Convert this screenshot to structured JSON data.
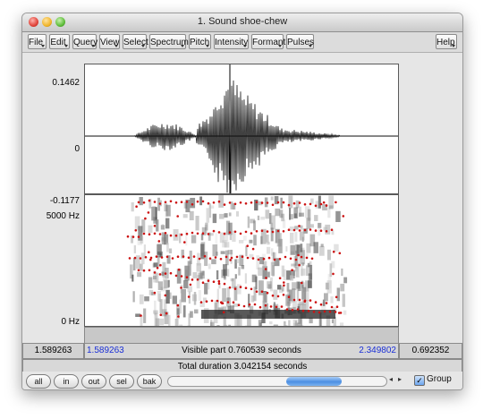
{
  "window": {
    "title": "1. Sound shoe-chew"
  },
  "menubar": {
    "items": [
      "File",
      "Edit",
      "Query",
      "View",
      "Select",
      "Spectrum",
      "Pitch",
      "Intensity",
      "Formant",
      "Pulses"
    ],
    "help": "Help"
  },
  "waveform": {
    "top_label": "0.1462",
    "zero_label": "0",
    "bottom_label": "-0.1177"
  },
  "spectrogram": {
    "top_label": "5000 Hz",
    "bottom_label": "0 Hz"
  },
  "selection": {
    "left_outer": "1.589263",
    "left_visible": "1.589263",
    "visible_text": "Visible part 0.760539 seconds",
    "right_visible": "2.349802",
    "right_outer": "0.692352"
  },
  "total": {
    "text": "Total duration 3.042154 seconds"
  },
  "bottom": {
    "buttons": [
      "all",
      "in",
      "out",
      "sel",
      "bak"
    ],
    "group_checked": "✓",
    "group_label": "Group"
  },
  "scrollbar": {
    "left_arrow": "◂",
    "right_arrow": "▸"
  },
  "colors": {
    "formant_dots": "#cc1111",
    "selection_blue": "#1a2fd6",
    "scroll_thumb": "#4c8fe2"
  }
}
